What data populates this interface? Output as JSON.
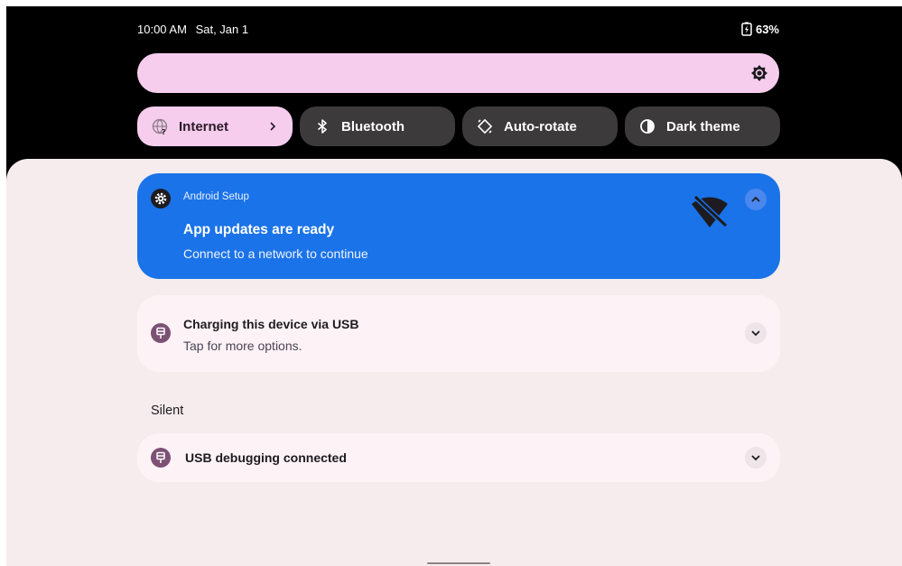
{
  "status_bar": {
    "time": "10:00 AM",
    "date": "Sat, Jan 1",
    "battery": "63%"
  },
  "brightness": {
    "icon": "brightness-icon"
  },
  "quick_tiles": [
    {
      "label": "Internet",
      "icon": "wifi-unknown-icon",
      "active": true
    },
    {
      "label": "Bluetooth",
      "icon": "bluetooth-icon",
      "active": false
    },
    {
      "label": "Auto-rotate",
      "icon": "auto-rotate-icon",
      "active": false
    },
    {
      "label": "Dark theme",
      "icon": "dark-theme-icon",
      "active": false
    }
  ],
  "notifications": {
    "setup": {
      "app": "Android Setup",
      "title": "App updates are ready",
      "text": "Connect to a network to continue",
      "color": "#1a73e8"
    },
    "usb": {
      "title": "Charging this device via USB",
      "text": "Tap for more options."
    },
    "section_label": "Silent",
    "debug": {
      "title": "USB debugging connected"
    }
  }
}
